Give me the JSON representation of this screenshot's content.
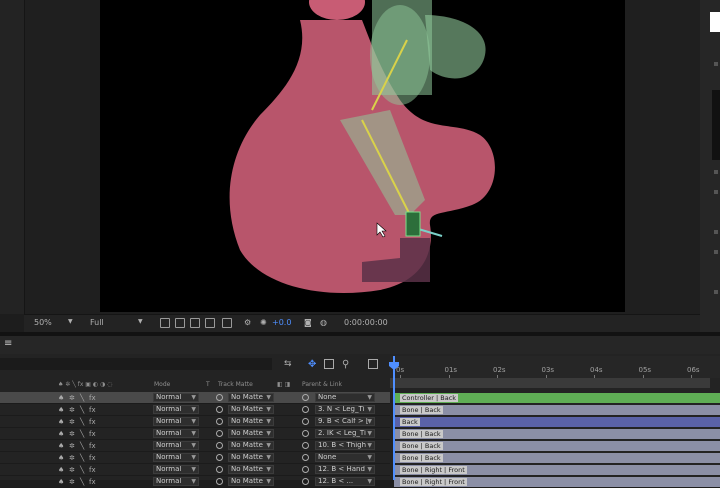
{
  "viewer": {
    "zoom": "50%",
    "resolution": "Full",
    "exposure": "+0.0",
    "timecode": "0:00:00:00"
  },
  "timeline": {
    "columns": {
      "mode": "Mode",
      "t": "T",
      "track_matte": "Track Matte",
      "parent_link": "Parent & Link"
    },
    "ruler_ticks": [
      "0s",
      "01s",
      "02s",
      "03s",
      "04s",
      "05s",
      "06s"
    ],
    "layers": [
      {
        "mode": "Normal",
        "matte": "No Matte",
        "parent": "None",
        "bar_label": "Controller | Back",
        "bar_color": "#5fae55"
      },
      {
        "mode": "Normal",
        "matte": "No Matte",
        "parent": "3. N < Leg_Ti",
        "bar_label": "Bone | Back",
        "bar_color": "#8b8fa6"
      },
      {
        "mode": "Normal",
        "matte": "No Matte",
        "parent": "9. B < Calf > [",
        "bar_label": "Back",
        "bar_color": "#5a62a8"
      },
      {
        "mode": "Normal",
        "matte": "No Matte",
        "parent": "2. IK < Leg_Ti",
        "bar_label": "Bone | Back",
        "bar_color": "#8b8fa6"
      },
      {
        "mode": "Normal",
        "matte": "No Matte",
        "parent": "10. B < Thigh",
        "bar_label": "Bone | Back",
        "bar_color": "#8b8fa6"
      },
      {
        "mode": "Normal",
        "matte": "No Matte",
        "parent": "None",
        "bar_label": "Bone | Back",
        "bar_color": "#8b8fa6"
      },
      {
        "mode": "Normal",
        "matte": "No Matte",
        "parent": "12. B < Hand",
        "bar_label": "Bone | Right | Front",
        "bar_color": "#8b8fa6"
      },
      {
        "mode": "Normal",
        "matte": "No Matte",
        "parent": "12. B < ...",
        "bar_label": "Bone | Right | Front",
        "bar_color": "#8b8fa6"
      }
    ]
  },
  "colors": {
    "pink_shape": "#c85c74",
    "green_shape": "#8fc89a",
    "bone_line": "#d9d24a",
    "selected_row": "#4a4a4a",
    "playhead": "#4f8fff"
  }
}
